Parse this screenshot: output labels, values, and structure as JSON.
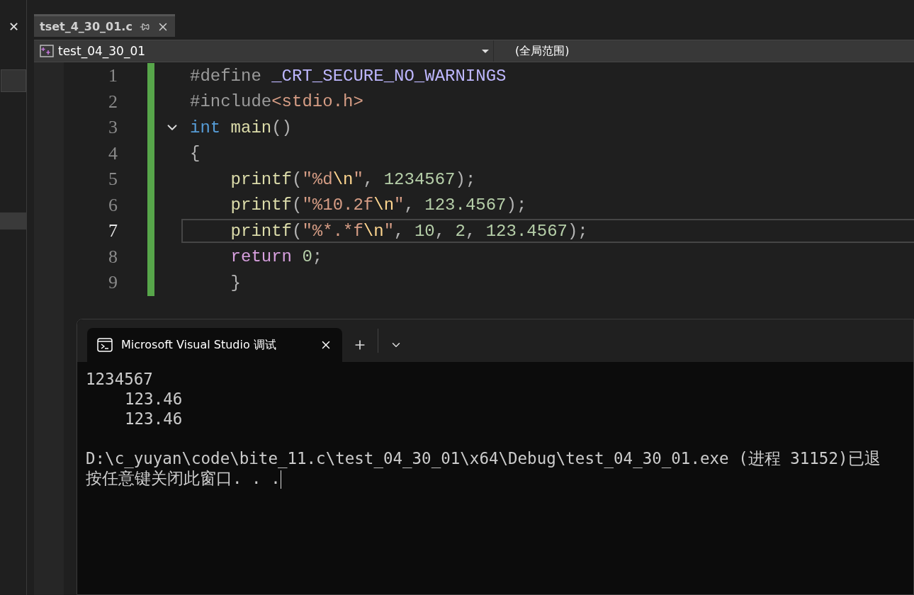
{
  "side_panel": {
    "close": "✕"
  },
  "document_tab": {
    "title": "tset_4_30_01.c",
    "selected": true
  },
  "nav_bar": {
    "project": "test_04_30_01",
    "scope": "(全局范围)"
  },
  "editor": {
    "lines": [
      {
        "number": "1",
        "current": false,
        "fold": false,
        "indented": false,
        "tokens": [
          {
            "t": "#define ",
            "kind": "pre"
          },
          {
            "t": "_CRT_SECURE_NO_WARNINGS",
            "kind": "macro"
          }
        ]
      },
      {
        "number": "2",
        "current": false,
        "fold": false,
        "indented": false,
        "tokens": [
          {
            "t": "#include",
            "kind": "pre"
          },
          {
            "t": "<stdio.h>",
            "kind": "str"
          }
        ]
      },
      {
        "number": "3",
        "current": false,
        "fold": true,
        "indented": false,
        "tokens": [
          {
            "t": "int ",
            "kind": "kw"
          },
          {
            "t": "main",
            "kind": "fn"
          },
          {
            "t": "()",
            "kind": "punc"
          }
        ]
      },
      {
        "number": "4",
        "current": false,
        "fold": false,
        "indented": false,
        "tokens": [
          {
            "t": "{",
            "kind": "punc"
          }
        ]
      },
      {
        "number": "5",
        "current": false,
        "fold": false,
        "indented": true,
        "tokens": [
          {
            "t": "printf",
            "kind": "fn"
          },
          {
            "t": "(",
            "kind": "punc"
          },
          {
            "t": "\"%d",
            "kind": "str"
          },
          {
            "t": "\\n",
            "kind": "esc"
          },
          {
            "t": "\"",
            "kind": "str"
          },
          {
            "t": ", ",
            "kind": "punc"
          },
          {
            "t": "1234567",
            "kind": "num"
          },
          {
            "t": ");",
            "kind": "punc"
          }
        ]
      },
      {
        "number": "6",
        "current": false,
        "fold": false,
        "indented": true,
        "tokens": [
          {
            "t": "printf",
            "kind": "fn"
          },
          {
            "t": "(",
            "kind": "punc"
          },
          {
            "t": "\"%10.2f",
            "kind": "str"
          },
          {
            "t": "\\n",
            "kind": "esc"
          },
          {
            "t": "\"",
            "kind": "str"
          },
          {
            "t": ", ",
            "kind": "punc"
          },
          {
            "t": "123.4567",
            "kind": "num"
          },
          {
            "t": ");",
            "kind": "punc"
          }
        ]
      },
      {
        "number": "7",
        "current": true,
        "fold": false,
        "indented": true,
        "tokens": [
          {
            "t": "printf",
            "kind": "fn"
          },
          {
            "t": "(",
            "kind": "punc"
          },
          {
            "t": "\"%*.*f",
            "kind": "str"
          },
          {
            "t": "\\n",
            "kind": "esc"
          },
          {
            "t": "\"",
            "kind": "str"
          },
          {
            "t": ", ",
            "kind": "punc"
          },
          {
            "t": "10",
            "kind": "num"
          },
          {
            "t": ", ",
            "kind": "punc"
          },
          {
            "t": "2",
            "kind": "num"
          },
          {
            "t": ", ",
            "kind": "punc"
          },
          {
            "t": "123.4567",
            "kind": "num"
          },
          {
            "t": ");",
            "kind": "punc"
          }
        ]
      },
      {
        "number": "8",
        "current": false,
        "fold": false,
        "indented": true,
        "tokens": [
          {
            "t": "return ",
            "kind": "ctl"
          },
          {
            "t": "0",
            "kind": "num"
          },
          {
            "t": ";",
            "kind": "punc"
          }
        ]
      },
      {
        "number": "9",
        "current": false,
        "fold": false,
        "indented": true,
        "tokens": [
          {
            "t": "}",
            "kind": "punc"
          }
        ]
      }
    ]
  },
  "console": {
    "tab": {
      "title": "Microsoft Visual Studio 调试",
      "selected": true
    },
    "output": [
      {
        "text": "1234567",
        "indented": false
      },
      {
        "text": "123.46",
        "indented": true
      },
      {
        "text": "123.46",
        "indented": true
      }
    ],
    "exit_messages": [
      {
        "text": "D:\\c_yuyan\\code\\bite_11.c\\test_04_30_01\\x64\\Debug\\test_04_30_01.exe (进程 31152)已退"
      },
      {
        "text": "按任意键关闭此窗口. . ."
      }
    ]
  }
}
